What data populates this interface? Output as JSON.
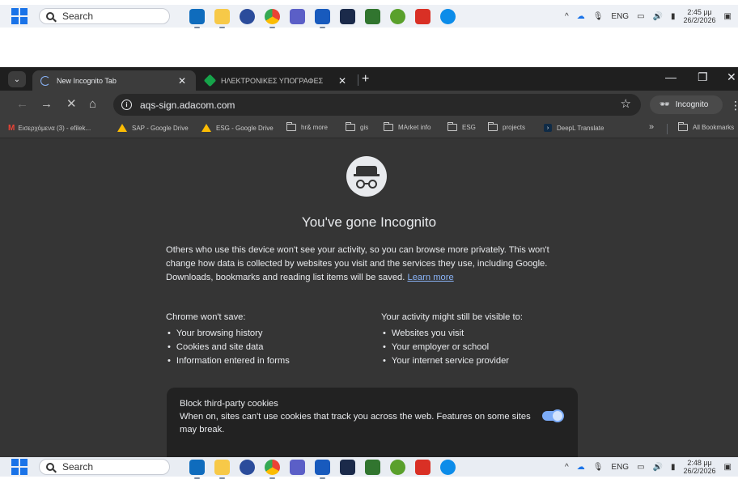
{
  "taskbar_top": {
    "search_label": "Search",
    "tray": {
      "lang": "ENG",
      "time": "2:45 μμ",
      "date": "26/2/2026"
    }
  },
  "taskbar_bottom": {
    "search_label": "Search",
    "tray": {
      "lang": "ENG",
      "time": "2:48 μμ",
      "date": "26/2/2026"
    }
  },
  "taskbar_apps": [
    "outlook-icon",
    "file-explorer-icon",
    "app-icon",
    "chrome-icon",
    "teams-icon",
    "word-icon",
    "app-icon",
    "planner-icon",
    "app-icon",
    "acrobat-icon",
    "edge-icon"
  ],
  "browser": {
    "tabs": [
      {
        "label": "New Incognito Tab",
        "active": true
      },
      {
        "label": "ΗΛΕΚΤΡΟΝΙΚΕΣ ΥΠΟΓΡΑΦΕΣ",
        "active": false
      }
    ],
    "url": "aqs-sign.adacom.com",
    "incognito_chip": "Incognito",
    "bookmarks": [
      {
        "label": "Εισερχόμενα (3) - efilek...",
        "icon": "gmail-icon"
      },
      {
        "label": "SAP - Google Drive",
        "icon": "drive-icon"
      },
      {
        "label": "ESG - Google Drive",
        "icon": "drive-icon"
      },
      {
        "label": "hr& more",
        "icon": "folder-icon"
      },
      {
        "label": "gis",
        "icon": "folder-icon"
      },
      {
        "label": "MArket info",
        "icon": "folder-icon"
      },
      {
        "label": "ESG",
        "icon": "folder-icon"
      },
      {
        "label": "projects",
        "icon": "folder-icon"
      },
      {
        "label": "DeepL Translate",
        "icon": "deepl-icon"
      }
    ],
    "all_bookmarks": "All Bookmarks",
    "overflow": "»"
  },
  "page": {
    "title": "You've gone Incognito",
    "intro": "Others who use this device won't see your activity, so you can browse more privately. This won't change how data is collected by websites you visit and the services they use, including Google. Downloads, bookmarks and reading list items will be saved.",
    "learn_more": "Learn more",
    "wont_save": {
      "heading": "Chrome won't save:",
      "items": [
        "Your browsing history",
        "Cookies and site data",
        "Information entered in forms"
      ]
    },
    "visible_to": {
      "heading": "Your activity might still be visible to:",
      "items": [
        "Websites you visit",
        "Your employer or school",
        "Your internet service provider"
      ]
    },
    "cookies": {
      "title": "Block third-party cookies",
      "description": "When on, sites can't use cookies that track you across the web. Features on some sites may break.",
      "enabled": true
    }
  },
  "colors": {
    "accent": "#8ab4f8",
    "page_bg": "#353535",
    "toolbar_bg": "#3c3c3c"
  }
}
